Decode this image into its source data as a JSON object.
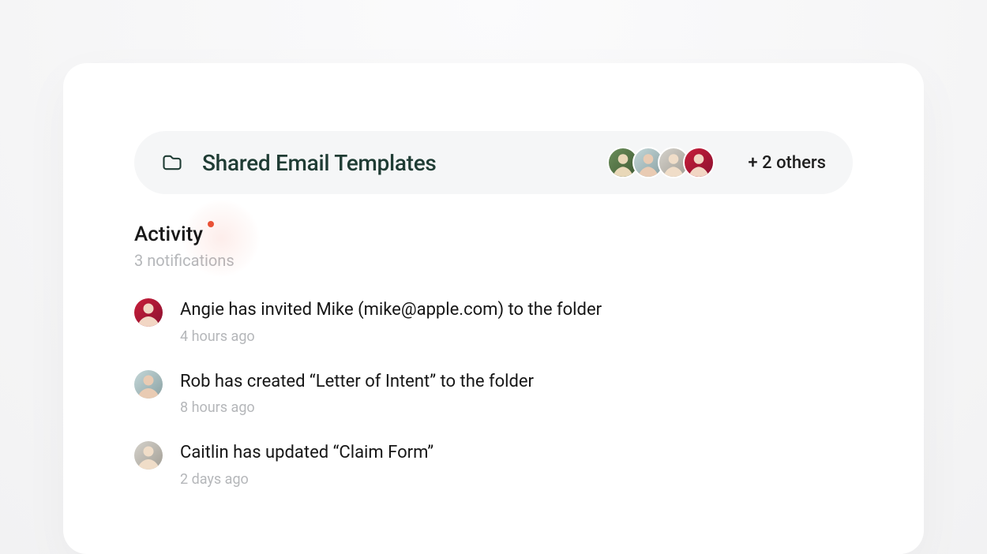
{
  "folder": {
    "title": "Shared Email Templates",
    "others_label": "+ 2 others"
  },
  "activity": {
    "title": "Activity",
    "subtitle": "3 notifications"
  },
  "feed": {
    "items": [
      {
        "text": "Angie has invited Mike (mike@apple.com) to the folder",
        "time": "4 hours ago"
      },
      {
        "text": "Rob has created “Letter of Intent” to the folder",
        "time": "8 hours ago"
      },
      {
        "text": "Caitlin has updated “Claim Form”",
        "time": "2 days ago"
      }
    ]
  }
}
